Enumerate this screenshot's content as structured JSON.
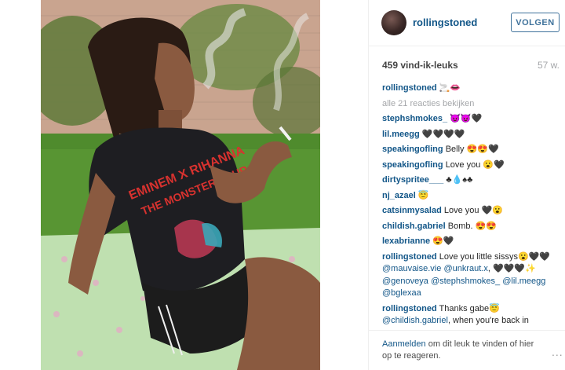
{
  "post": {
    "username": "rollingstoned",
    "follow_label": "VOLGEN",
    "likes": "459 vind-ik-leuks",
    "age": "57 w.",
    "caption_user": "rollingstoned",
    "caption_text": "🚬👄",
    "view_all": "alle 21 reacties bekijken"
  },
  "comments": [
    {
      "user": "stephshmokes_",
      "text": "😈😈🖤"
    },
    {
      "user": "lil.meegg",
      "text": "🖤🖤🖤🖤"
    },
    {
      "user": "speakingofling",
      "text": "Belly 😍😍🖤"
    },
    {
      "user": "speakingofling",
      "text": "Love you 😮🖤"
    },
    {
      "user": "dirtyspritee___",
      "text": "♣💧♠♣"
    },
    {
      "user": "nj_azael",
      "text": "😇"
    },
    {
      "user": "catsinmysalad",
      "text": "Love you 🖤😮"
    },
    {
      "user": "childish.gabriel",
      "text": "Bomb. 😍😍"
    },
    {
      "user": "lexabrianne",
      "text": "😍🖤"
    }
  ],
  "long_comment_1": {
    "user": "rollingstoned",
    "text1": "Love you little sissys😮🖤🖤",
    "mention1": "@mauvaise.vie",
    "mention2": "@unkraut.x",
    "text2": ", 🖤🖤🖤✨",
    "mention3": "@genoveya",
    "mention4": "@stephshmokes_",
    "mention5": "@lil.meegg",
    "mention6": "@bglexaa"
  },
  "long_comment_2": {
    "user": "rollingstoned",
    "text1": "Thanks gabe😇",
    "mention1": "@childish.gabriel",
    "text2": ", when you're back in"
  },
  "footer": {
    "login_link": "Aanmelden",
    "text": "om dit leuk te vinden of hier op te reageren.",
    "more": "..."
  },
  "photo": {
    "shirt_text_line1": "EMINEM X RIHANNA",
    "shirt_text_line2": "THE MONSTER TOUR"
  },
  "colors": {
    "link": "#125688",
    "follow": "#3f729b",
    "muted": "#a5a7aa"
  }
}
